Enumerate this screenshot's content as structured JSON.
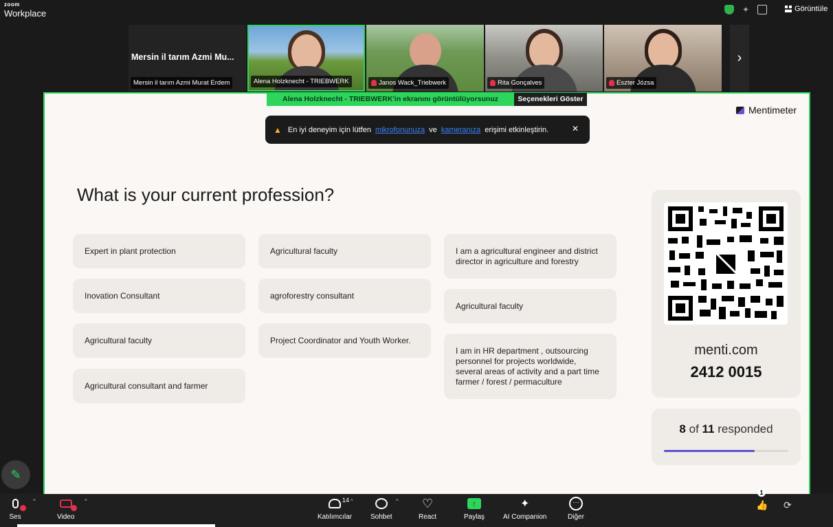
{
  "app": {
    "brand_small": "zoom",
    "brand_name": "Workplace",
    "view_label": "Görüntüle"
  },
  "participants": [
    {
      "tile_name": "Mersin il tarım Azmi Mu...",
      "label": "Mersin il tarım Azmi Murat Erdem",
      "muted": false,
      "video": false
    },
    {
      "label": "Alena Holzknecht - TRIEBWERK",
      "muted": false,
      "video": true,
      "active": true
    },
    {
      "label": "Janos Wack_Triebwerk",
      "muted": true,
      "video": true
    },
    {
      "label": "Rita Gonçalves",
      "muted": true,
      "video": true
    },
    {
      "label": "Eszter Józsa",
      "muted": true,
      "video": true
    }
  ],
  "share_banner": {
    "status": "Alena Holzknecht - TRIEBWERK'in ekranını görüntülüyorsunuz",
    "options": "Seçenekleri Göster"
  },
  "toast": {
    "text_before": "En iyi deneyim için lütfen",
    "link1": "mikrofonunuza",
    "text_middle": "ve",
    "link2": "kameranıza",
    "text_after": "erişimi etkinleştirin.",
    "close": "✕"
  },
  "mentimeter": {
    "logo": "Mentimeter",
    "question": "What is your current profession?",
    "columns": [
      [
        "Expert in plant protection",
        "Inovation Consultant",
        "Agricultural faculty",
        "Agricultural consultant and farmer"
      ],
      [
        "Agricultural faculty",
        "agroforestry consultant",
        "Project Coordinator and Youth Worker."
      ],
      [
        "I am a agricultural engineer and district director in agriculture and forestry",
        "Agricultural faculty",
        "I am in HR department , outsourcing personnel for projects worldwide, several areas of activity and a part time farmer / forest / permaculture"
      ]
    ],
    "join_url": "menti.com",
    "join_code": "2412 0015",
    "responded": {
      "count": "8",
      "of": "of",
      "total": "11",
      "suffix": "responded",
      "fraction": 0.727
    }
  },
  "toolbar": {
    "audio": "Ses",
    "video": "Video",
    "participants": "Katılımcılar",
    "participants_count": "14",
    "chat": "Sohbet",
    "react": "React",
    "share": "Paylaş",
    "ai": "AI Companion",
    "more": "Diğer",
    "reaction_badge": "1"
  }
}
